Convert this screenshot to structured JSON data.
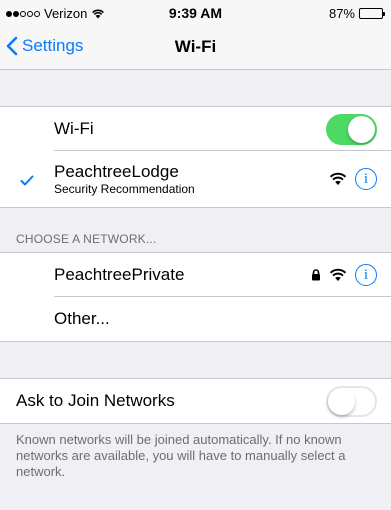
{
  "status": {
    "carrier": "Verizon",
    "time": "9:39 AM",
    "battery": "87%",
    "battery_level": 0.87
  },
  "nav": {
    "back_label": "Settings",
    "title": "Wi-Fi"
  },
  "wifi": {
    "label": "Wi-Fi",
    "enabled": true
  },
  "connected": {
    "name": "PeachtreeLodge",
    "subtitle": "Security Recommendation"
  },
  "networks": {
    "header": "CHOOSE A NETWORK...",
    "items": [
      {
        "name": "PeachtreePrivate",
        "locked": true
      }
    ],
    "other_label": "Other..."
  },
  "ask_join": {
    "label": "Ask to Join Networks",
    "enabled": false,
    "footer": "Known networks will be joined automatically. If no known networks are available, you will have to manually select a network."
  },
  "colors": {
    "accent": "#0a7aff",
    "toggle_on": "#4cd964"
  }
}
